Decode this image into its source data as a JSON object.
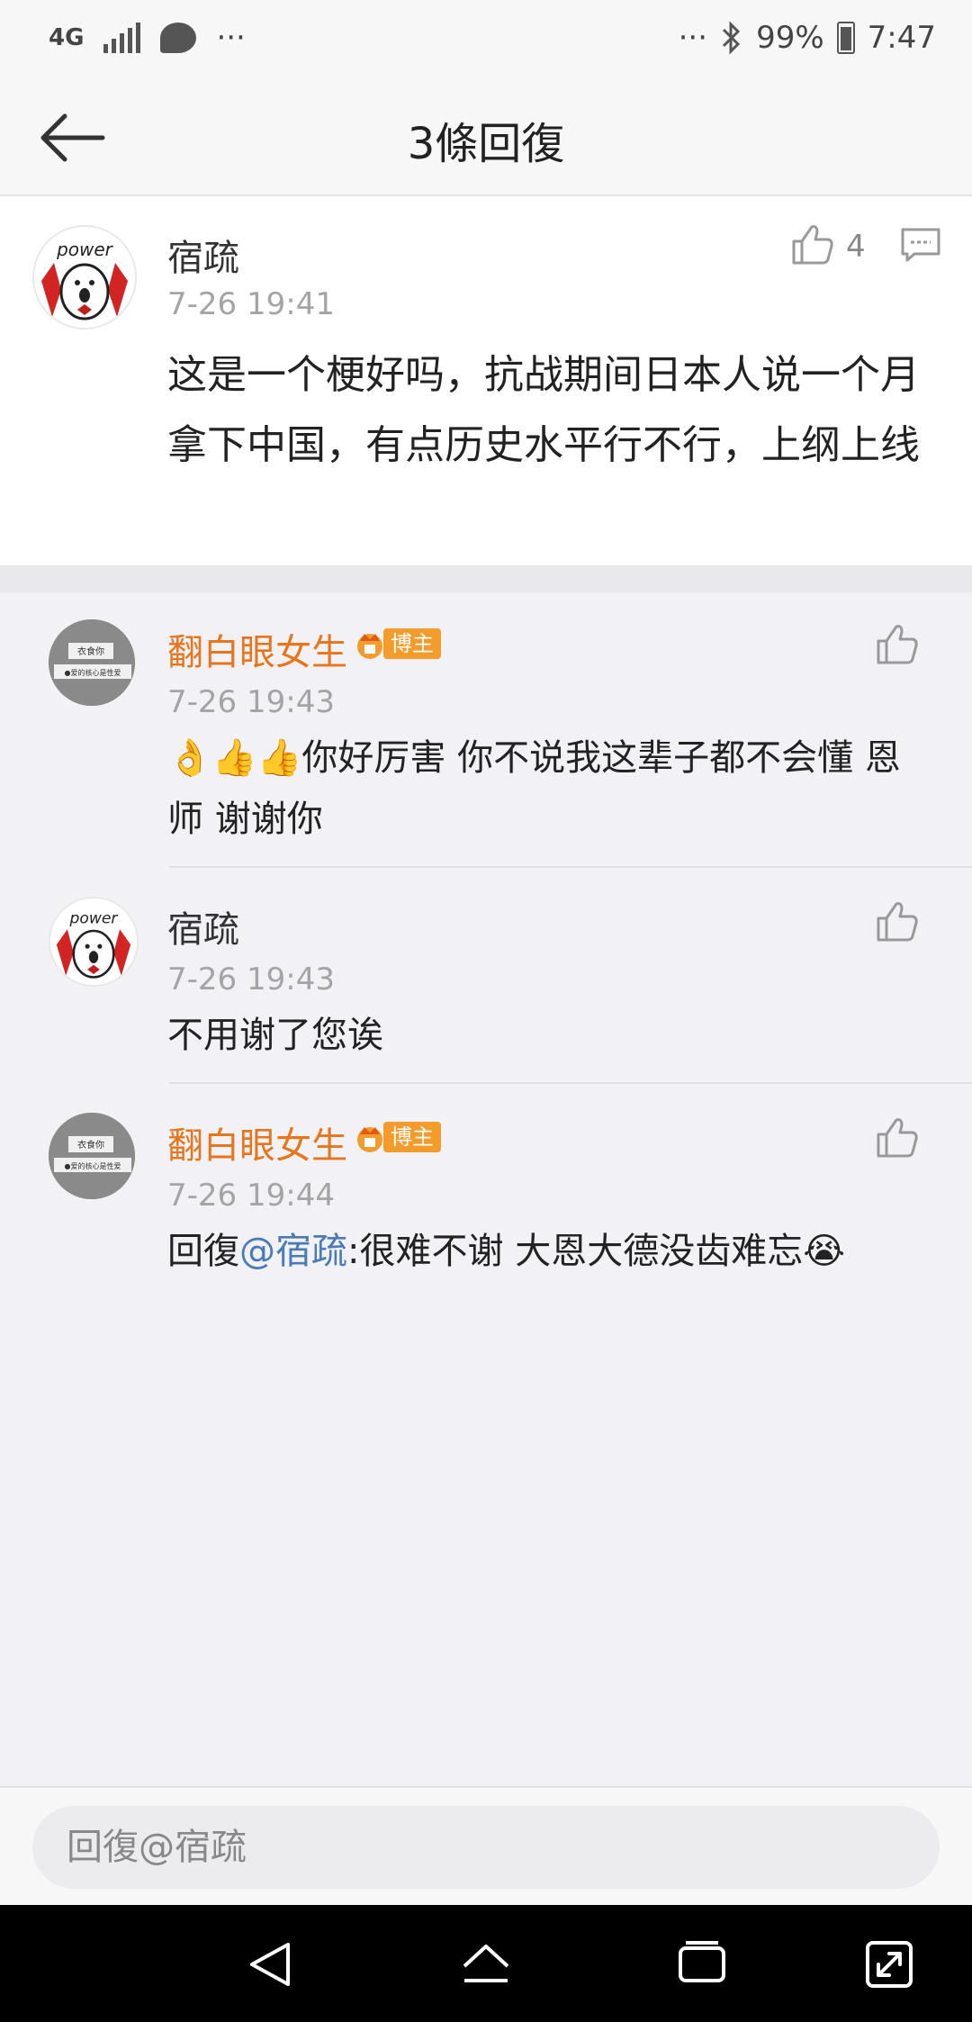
{
  "status_bar": {
    "network": "4G",
    "left_more": "···",
    "right_more": "···",
    "battery": "99%",
    "time": "7:47"
  },
  "nav": {
    "title": "3條回復"
  },
  "main_comment": {
    "username": "宿疏",
    "time": "7-26 19:41",
    "like_count": "4",
    "text": "这是一个梗好吗，抗战期间日本人说一个月拿下中国，有点历史水平行不行，上纲上线",
    "avatar_text": "power"
  },
  "replies": [
    {
      "username": "翻白眼女生",
      "badge": "博主",
      "time": "7-26 19:43",
      "emojis": "👌👍👍",
      "text": "你好厉害 你不说我这辈子都不会懂 恩师 谢谢你",
      "avatar_text1": "衣食你",
      "avatar_text2": "●爱的核心是性爱"
    },
    {
      "username": "宿疏",
      "time": "7-26 19:43",
      "text": "不用谢了您诶",
      "avatar_text": "power"
    },
    {
      "username": "翻白眼女生",
      "badge": "博主",
      "time": "7-26 19:44",
      "reply_prefix": "回復",
      "mention": "@宿疏",
      "text": ":很难不谢 大恩大德没齿难忘",
      "emoji": "😭",
      "avatar_text1": "衣食你",
      "avatar_text2": "●爱的核心是性爱"
    }
  ],
  "compose": {
    "placeholder": "回復@宿疏"
  },
  "colors": {
    "accent_orange": "#e8741b",
    "mention_blue": "#4a7bb7",
    "background": "#f2f2f6"
  }
}
